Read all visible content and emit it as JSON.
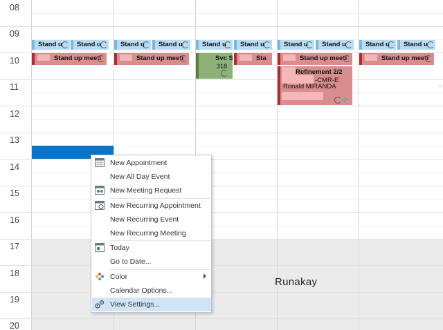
{
  "calendar": {
    "hours": [
      "08",
      "09",
      "10",
      "11",
      "12",
      "13",
      "14",
      "15",
      "16",
      "17",
      "18",
      "19",
      "20"
    ],
    "standup_short_label": "Stand u",
    "standup_short_label_partial": "Sta",
    "standup_label": "Stand up meeti",
    "svc_label": "Svc S",
    "svc_detail": "318",
    "refinement": {
      "title": "Refinement 2/2",
      "code": "-CMR-E",
      "organizer": "Ronald MIRANDA"
    }
  },
  "context_menu": {
    "items": [
      {
        "label": "New Appointment",
        "icon": "calendar-grid-icon"
      },
      {
        "label": "New All Day Event",
        "icon": ""
      },
      {
        "label": "New Meeting Request",
        "icon": "meeting-request-icon"
      },
      {
        "label": "New Recurring Appointment",
        "icon": "recurring-calendar-icon"
      },
      {
        "label": "New Recurring Event",
        "icon": ""
      },
      {
        "label": "New Recurring Meeting",
        "icon": ""
      },
      {
        "label": "Today",
        "icon": "today-calendar-icon"
      },
      {
        "label": "Go to Date...",
        "icon": ""
      },
      {
        "label": "Color",
        "icon": "color-palette-icon"
      },
      {
        "label": "Calendar Options...",
        "icon": ""
      },
      {
        "label": "View Settings...",
        "icon": "view-settings-icon"
      }
    ],
    "highlighted_item": "View Settings..."
  },
  "watermark": "Runakay",
  "colors": {
    "standup": "#d98d8d",
    "standup_border": "#b2292e",
    "standup_short": "#b7dcf3",
    "svc": "#8db278",
    "selection": "#0a74c9",
    "menu_highlight": "#cfe4f6"
  }
}
